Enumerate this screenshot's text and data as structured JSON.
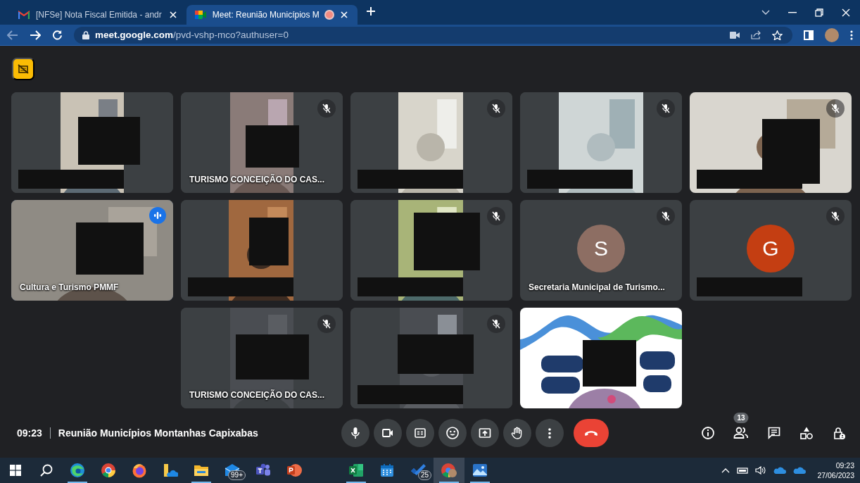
{
  "browser": {
    "tabs": [
      {
        "title": "[NFSe] Nota Fiscal Emitida - andr",
        "selected": false,
        "recording": false
      },
      {
        "title": "Meet: Reunião Municípios M",
        "selected": true,
        "recording": true
      }
    ],
    "url_host": "meet.google.com",
    "url_path": "/pvd-vshp-mco?authuser=0"
  },
  "meeting": {
    "rows": [
      [
        {
          "kind": "video",
          "muted": false,
          "speaking": false,
          "redacted": true
        },
        {
          "kind": "video",
          "muted": true,
          "speaking": false,
          "redacted": false,
          "name": "TURISMO CONCEIÇÃO DO CAS..."
        },
        {
          "kind": "video",
          "muted": true,
          "speaking": false,
          "redacted": true
        },
        {
          "kind": "video",
          "muted": true,
          "speaking": false,
          "redacted": true
        },
        {
          "kind": "video",
          "muted": true,
          "speaking": false,
          "redacted": true
        }
      ],
      [
        {
          "kind": "video",
          "muted": false,
          "speaking": true,
          "redacted": false,
          "name": "Cultura e Turismo PMMF"
        },
        {
          "kind": "video",
          "muted": false,
          "speaking": false,
          "redacted": true
        },
        {
          "kind": "video",
          "muted": true,
          "speaking": false,
          "redacted": true
        },
        {
          "kind": "avatar",
          "initial": "S",
          "color": "#8d6e63",
          "muted": true,
          "speaking": false,
          "redacted": false,
          "name": "Secretaria Municipal de Turismo..."
        },
        {
          "kind": "avatar",
          "initial": "G",
          "color": "#c43e12",
          "muted": true,
          "speaking": false,
          "redacted": true
        }
      ],
      [
        "",
        {
          "kind": "video",
          "muted": true,
          "speaking": false,
          "redacted": false,
          "name": "TURISMO CONCEIÇÃO DO CAS..."
        },
        {
          "kind": "video",
          "muted": true,
          "speaking": false,
          "redacted": true
        },
        {
          "kind": "self",
          "muted": false,
          "speaking": false,
          "redacted": false
        }
      ]
    ],
    "time": "09:23",
    "title": "Reunião Municípios Montanhas Capixabas",
    "participant_count": "13"
  },
  "taskbar": {
    "apps": [
      {
        "kind": "start",
        "active": false,
        "selected": false
      },
      {
        "kind": "search",
        "active": false,
        "selected": false
      },
      {
        "kind": "edge",
        "active": true,
        "selected": false
      },
      {
        "kind": "chrome",
        "active": false,
        "selected": false
      },
      {
        "kind": "firefox",
        "active": false,
        "selected": false
      },
      {
        "kind": "cloudfolder",
        "active": false,
        "selected": false
      },
      {
        "kind": "explorer",
        "active": true,
        "selected": false
      },
      {
        "kind": "mail",
        "active": false,
        "selected": false,
        "badge": "99+"
      },
      {
        "kind": "teams",
        "active": false,
        "selected": false
      },
      {
        "kind": "powerpoint",
        "active": false,
        "selected": false
      },
      {
        "kind": "excel",
        "active": true,
        "selected": false
      },
      {
        "kind": "calendar",
        "active": false,
        "selected": false
      },
      {
        "kind": "todo",
        "active": false,
        "selected": false,
        "badge": "25"
      },
      {
        "kind": "chromeprofile",
        "active": true,
        "selected": true
      },
      {
        "kind": "photos",
        "active": true,
        "selected": false
      }
    ],
    "time": "09:23",
    "date": "27/06/2023"
  }
}
